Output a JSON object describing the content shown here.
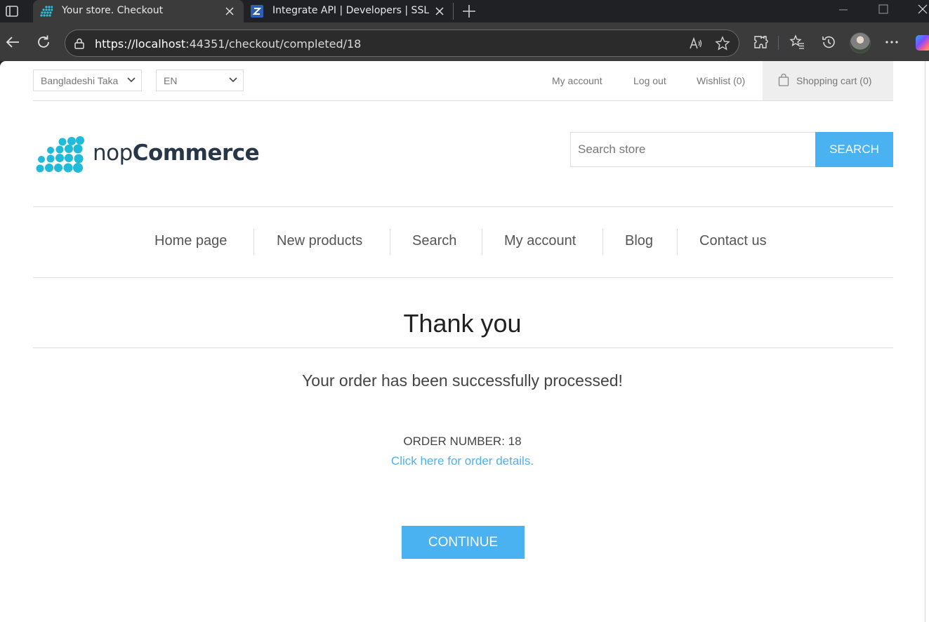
{
  "browser": {
    "tabs": [
      {
        "title": "Your store. Checkout",
        "active": true,
        "favicon": "nopcommerce-dots-icon"
      },
      {
        "title": "Integrate API | Developers | SSLCOMMERZ",
        "active": false,
        "favicon": "z-letter-icon"
      }
    ],
    "url_host": "https://localhost",
    "url_path": ":44351/checkout/completed/18"
  },
  "header": {
    "currency": "Bangladeshi Taka",
    "language": "EN",
    "links": {
      "my_account": "My account",
      "log_out": "Log out",
      "wishlist": "Wishlist (0)",
      "shopping_cart": "Shopping cart (0)"
    }
  },
  "logo": {
    "prefix": "nop",
    "suffix": "Commerce",
    "dot_color": "#1fbbd8"
  },
  "search": {
    "placeholder": "Search store",
    "button": "SEARCH"
  },
  "menu": {
    "items": [
      "Home page",
      "New products",
      "Search",
      "My account",
      "Blog",
      "Contact us"
    ]
  },
  "main": {
    "title": "Thank you",
    "success_message": "Your order has been successfully processed!",
    "order_number": "ORDER NUMBER: 18",
    "order_details_link": "Click here for order details.",
    "continue_button": "CONTINUE"
  },
  "colors": {
    "accent": "#4ab2f1",
    "text": "#444444",
    "muted": "#777777"
  }
}
